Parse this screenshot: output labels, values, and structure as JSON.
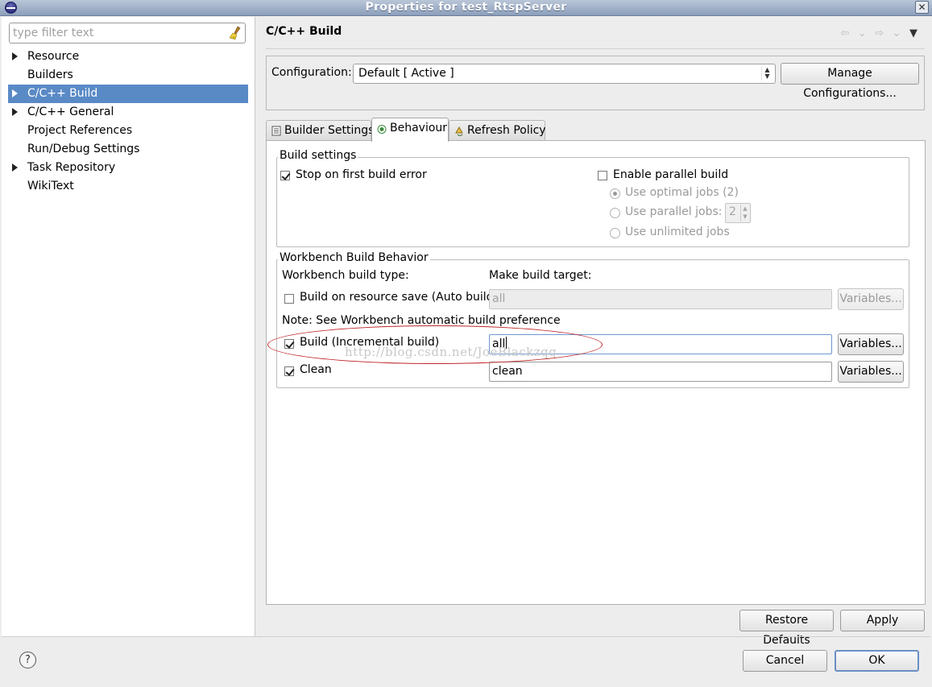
{
  "window": {
    "title": "Properties for test_RtspServer",
    "close_label": "✕"
  },
  "filter": {
    "placeholder": "type filter text"
  },
  "tree": [
    {
      "label": "Resource",
      "expandable": true
    },
    {
      "label": "Builders",
      "expandable": false
    },
    {
      "label": "C/C++ Build",
      "expandable": true,
      "selected": true
    },
    {
      "label": "C/C++ General",
      "expandable": true
    },
    {
      "label": "Project References",
      "expandable": false
    },
    {
      "label": "Run/Debug Settings",
      "expandable": false
    },
    {
      "label": "Task Repository",
      "expandable": true
    },
    {
      "label": "WikiText",
      "expandable": false
    }
  ],
  "page": {
    "title": "C/C++ Build"
  },
  "config": {
    "label": "Configuration:",
    "value": "Default  [ Active ]",
    "manage_label": "Manage Configurations..."
  },
  "tabs": {
    "builder_settings": "Builder Settings",
    "behaviour": "Behaviour",
    "refresh_policy": "Refresh Policy",
    "active": "behaviour"
  },
  "build_settings": {
    "legend": "Build settings",
    "stop_on_error": {
      "label": "Stop on first build error",
      "checked": true
    },
    "parallel": {
      "label": "Enable parallel build",
      "checked": false
    },
    "optimal_jobs": {
      "label": "Use optimal jobs (2)",
      "selected": true,
      "enabled": false
    },
    "parallel_jobs": {
      "label": "Use parallel jobs:",
      "value": "2",
      "enabled": false
    },
    "unlimited_jobs": {
      "label": "Use unlimited jobs",
      "enabled": false
    }
  },
  "workbench": {
    "legend": "Workbench Build Behavior",
    "build_type_label": "Workbench build type:",
    "make_target_label": "Make build target:",
    "auto_build": {
      "label": "Build on resource save (Auto build)",
      "checked": false,
      "value": "all",
      "enabled": false
    },
    "note": "Note: See Workbench automatic build preference",
    "incremental": {
      "label": "Build (Incremental build)",
      "checked": true,
      "value": "all"
    },
    "clean": {
      "label": "Clean",
      "checked": true,
      "value": "clean"
    },
    "variables_label": "Variables..."
  },
  "watermark": "http://blog.csdn.net/JoeBlackzqq",
  "buttons": {
    "restore_defaults": "Restore Defaults",
    "apply": "Apply",
    "cancel": "Cancel",
    "ok": "OK",
    "help": "?"
  },
  "colors": {
    "selection": "#5a8ac6",
    "annotation": "#c0262b"
  }
}
